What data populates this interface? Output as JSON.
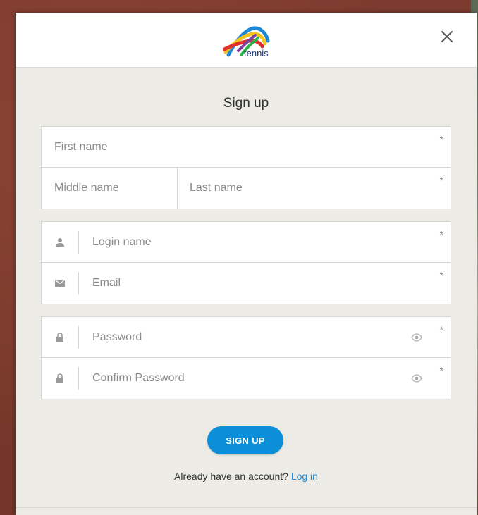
{
  "header": {
    "logo_text": "tennis",
    "close_label": "Close"
  },
  "form": {
    "title": "Sign up",
    "required_marker": "*",
    "first_name": {
      "placeholder": "First name",
      "value": ""
    },
    "middle_name": {
      "placeholder": "Middle name",
      "value": ""
    },
    "last_name": {
      "placeholder": "Last name",
      "value": ""
    },
    "login_name": {
      "placeholder": "Login name",
      "value": ""
    },
    "email": {
      "placeholder": "Email",
      "value": ""
    },
    "password": {
      "placeholder": "Password",
      "value": ""
    },
    "confirm_password": {
      "placeholder": "Confirm Password",
      "value": ""
    },
    "submit_label": "SIGN UP",
    "login_prompt": "Already have an account?",
    "login_link": "Log in"
  },
  "colors": {
    "accent": "#0a8fd8",
    "link": "#1a8ad4",
    "panel_bg": "#ecebe6"
  },
  "icons": {
    "login": "user-icon",
    "email": "envelope-icon",
    "password": "lock-icon",
    "reveal": "eye-icon",
    "close": "close-icon"
  }
}
